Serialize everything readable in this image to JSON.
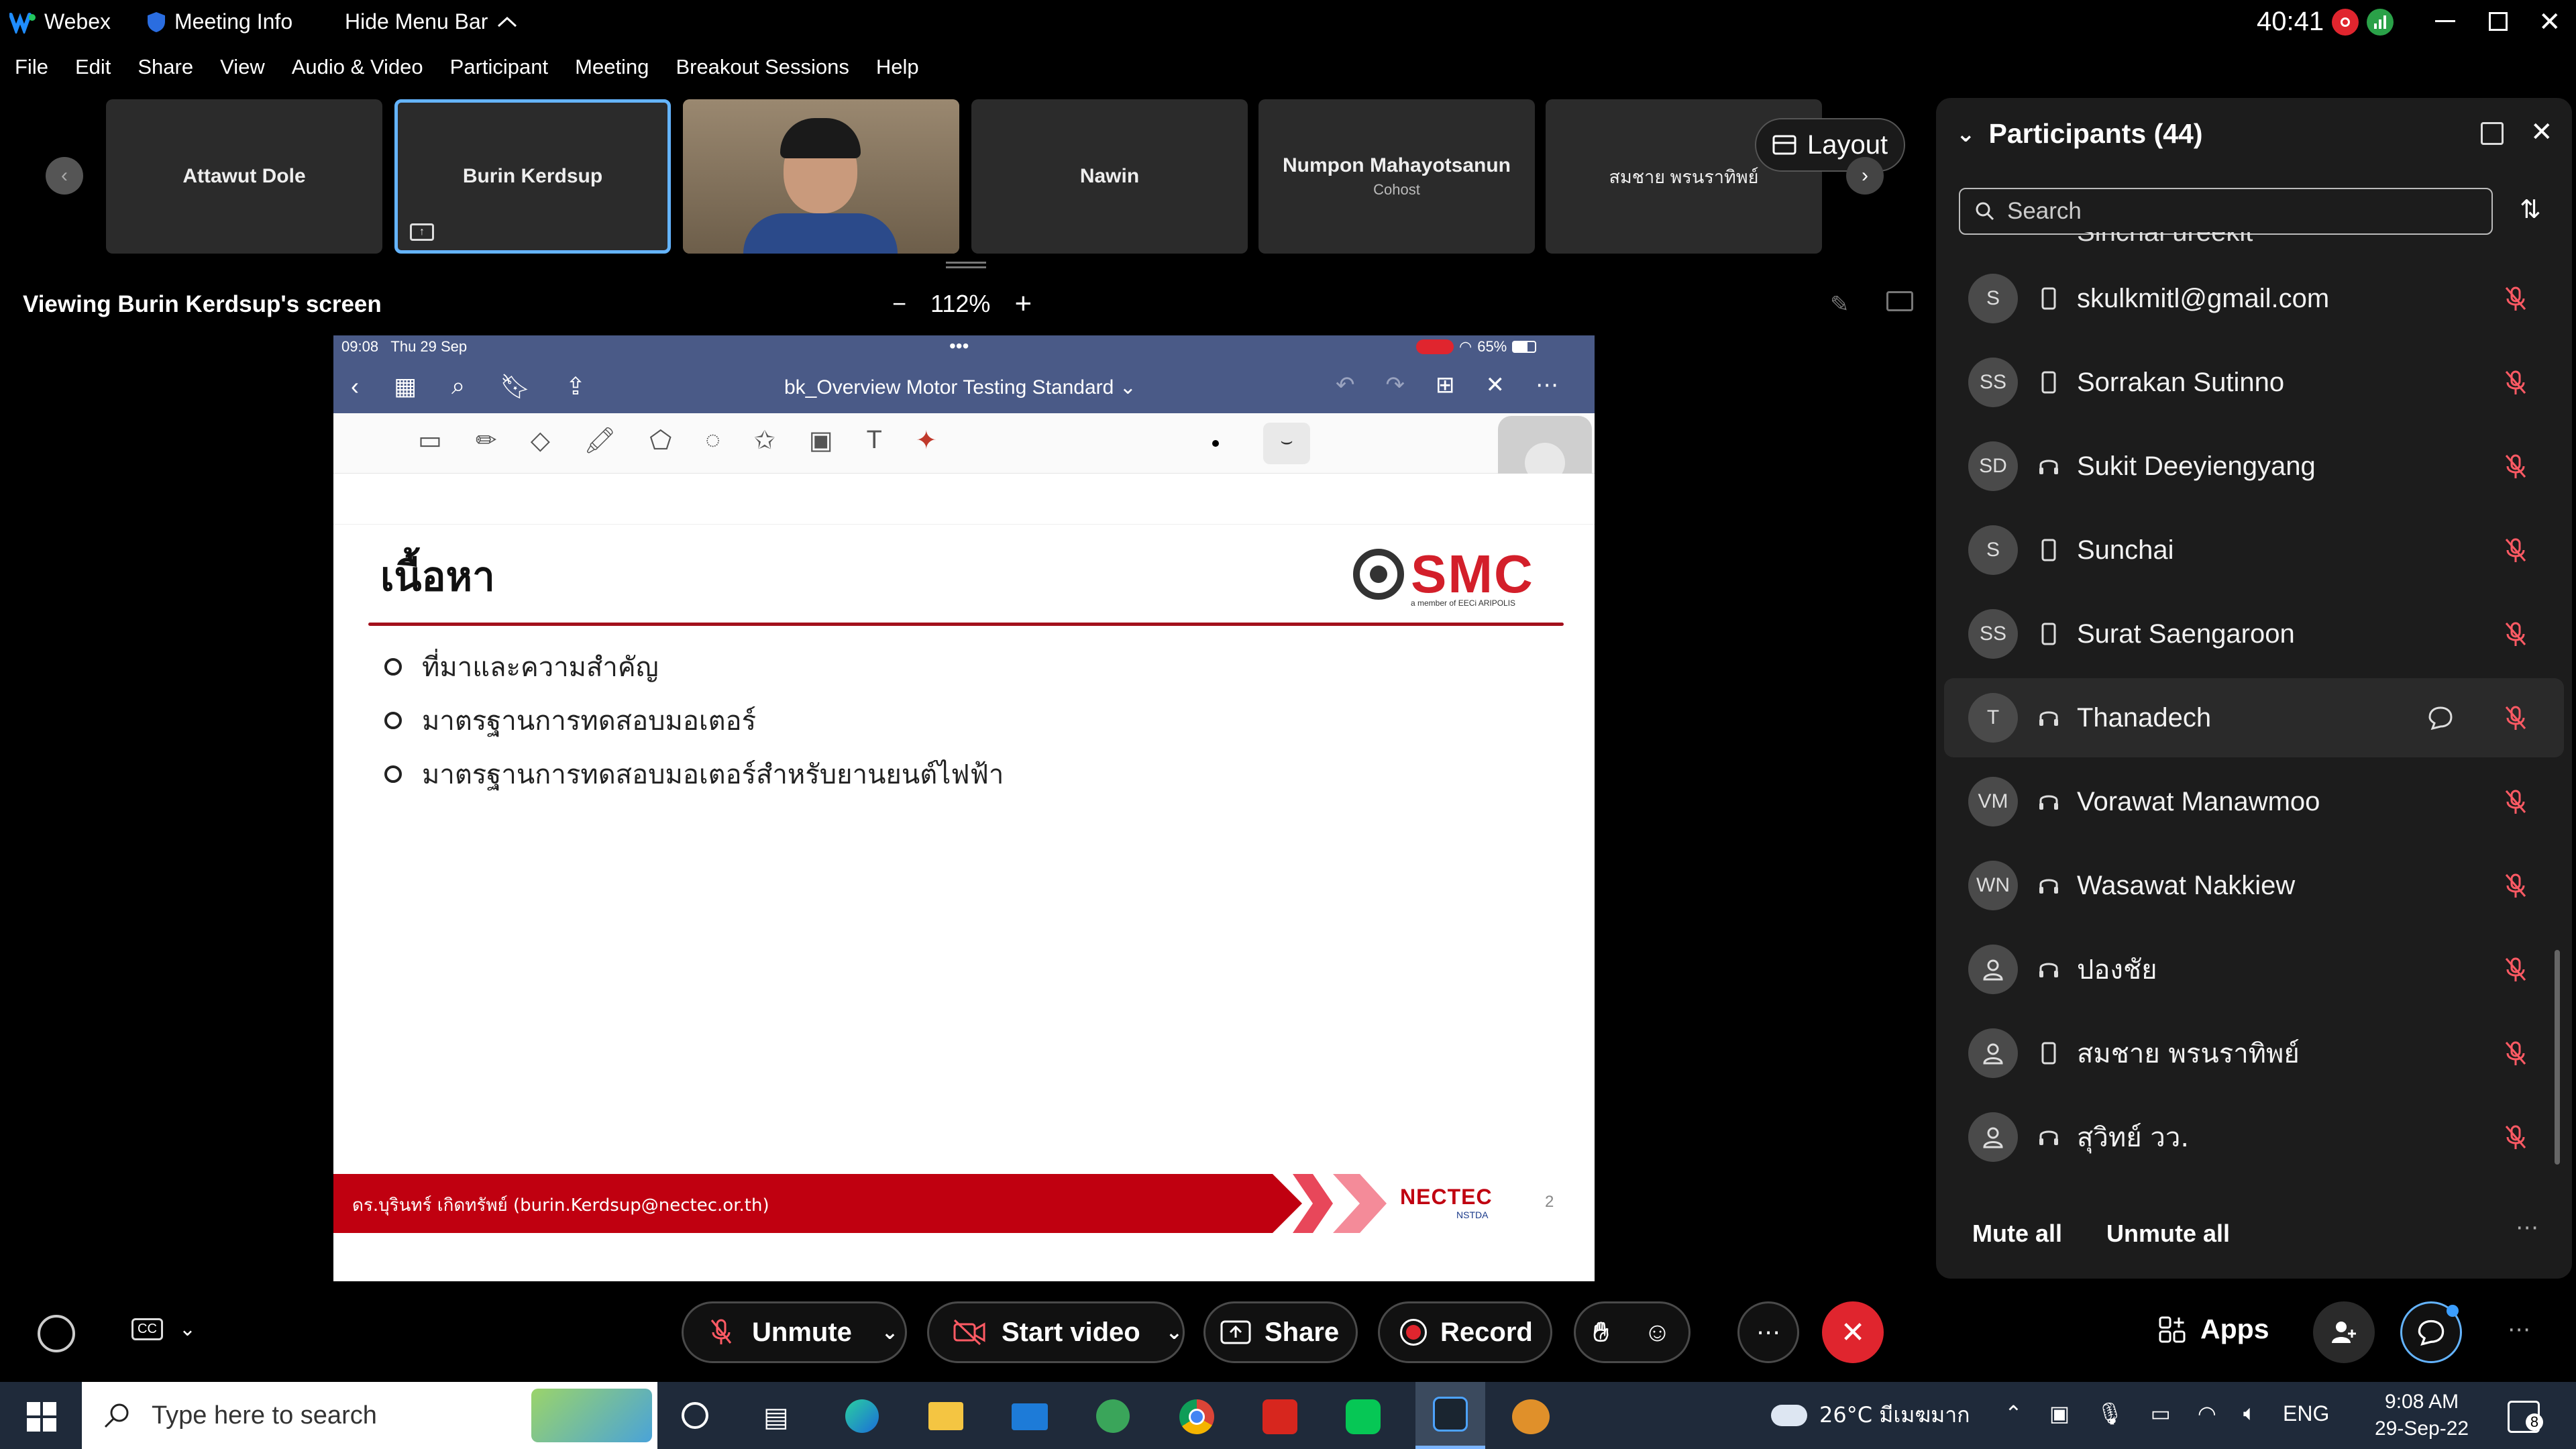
{
  "titlebar": {
    "app_name": "Webex",
    "meeting_info": "Meeting Info",
    "hide_menu": "Hide Menu Bar",
    "timer": "40:41"
  },
  "menu": [
    "File",
    "Edit",
    "Share",
    "View",
    "Audio & Video",
    "Participant",
    "Meeting",
    "Breakout Sessions",
    "Help"
  ],
  "thumbnails": [
    {
      "name": "Attawut Dole",
      "sub": ""
    },
    {
      "name": "Burin Kerdsup",
      "sub": ""
    },
    {
      "name": "",
      "sub": ""
    },
    {
      "name": "Nawin",
      "sub": ""
    },
    {
      "name": "Numpon Mahayotsanun",
      "sub": "Cohost"
    },
    {
      "name": "สมชาย พรนราทิพย์",
      "sub": ""
    }
  ],
  "layout_label": "Layout",
  "viewing_label": "Viewing Burin Kerdsup's screen",
  "zoom": "112%",
  "ipad": {
    "time": "09:08",
    "date": "Thu 29 Sep",
    "battery": "65%",
    "doc_title": "bk_Overview Motor Testing Standard"
  },
  "slide": {
    "heading": "เนื้อหา",
    "logo": "SMC",
    "logo_sub": "a member of EECi ARIPOLIS",
    "bullets": [
      "ที่มาและความสำคัญ",
      "มาตรฐานการทดสอบมอเตอร์",
      "มาตรฐานการทดสอบมอเตอร์สำหรับยานยนต์ไฟฟ้า"
    ],
    "footer_author": "ดร.บุรินทร์ เกิดทรัพย์ (burin.Kerdsup@nectec.or.th)",
    "footer_logo": "NECTEC",
    "footer_logo_sub": "NSTDA",
    "page": "2"
  },
  "participants": {
    "title": "Participants (44)",
    "search_placeholder": "Search",
    "partial_top": "Sinchai ureekit",
    "list": [
      {
        "initials": "S",
        "name": "skulkmitl@gmail.com",
        "device": "mobile",
        "chat": false
      },
      {
        "initials": "SS",
        "name": "Sorrakan Sutinno",
        "device": "mobile",
        "chat": false
      },
      {
        "initials": "SD",
        "name": "Sukit Deeyiengyang",
        "device": "headset",
        "chat": false
      },
      {
        "initials": "S",
        "name": "Sunchai",
        "device": "mobile",
        "chat": false
      },
      {
        "initials": "SS",
        "name": "Surat Saengaroon",
        "device": "mobile",
        "chat": false
      },
      {
        "initials": "T",
        "name": "Thanadech",
        "device": "headset",
        "chat": true
      },
      {
        "initials": "VM",
        "name": "Vorawat Manawmoo",
        "device": "headset",
        "chat": false
      },
      {
        "initials": "WN",
        "name": "Wasawat Nakkiew",
        "device": "headset",
        "chat": false
      },
      {
        "initials": "",
        "name": "ปองชัย",
        "device": "headset",
        "chat": false
      },
      {
        "initials": "",
        "name": "สมชาย พรนราทิพย์",
        "device": "mobile",
        "chat": false
      },
      {
        "initials": "",
        "name": "สุวิทย์ วว.",
        "device": "headset",
        "chat": false
      }
    ],
    "mute_all": "Mute all",
    "unmute_all": "Unmute all"
  },
  "controls": {
    "unmute": "Unmute",
    "start_video": "Start video",
    "share": "Share",
    "record": "Record",
    "apps": "Apps"
  },
  "taskbar": {
    "search_placeholder": "Type here to search",
    "weather": "26°C มีเมฆมาก",
    "lang": "ENG",
    "time": "9:08 AM",
    "date": "29-Sep-22",
    "notif_count": "8"
  },
  "colors": {
    "accent_blue": "#64b4ff",
    "red": "#e0252e",
    "slide_red": "#c00010",
    "ipad_bar": "#4a5a87"
  }
}
